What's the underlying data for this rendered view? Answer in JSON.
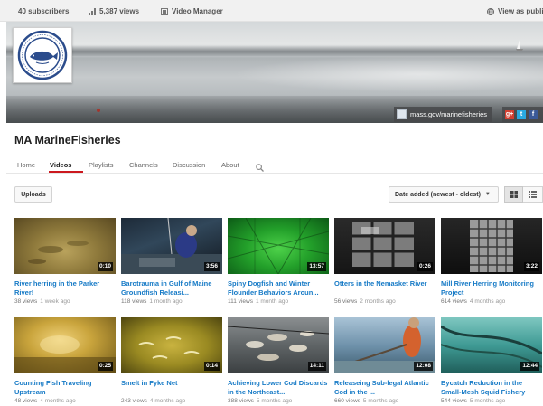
{
  "topbar": {
    "subscribers": "40 subscribers",
    "views": "5,387 views",
    "video_manager": "Video Manager",
    "view_as": "View as public"
  },
  "banner": {
    "site_link": "mass.gov/marinefisheries",
    "social_icons": [
      "google-plus-icon",
      "twitter-icon",
      "facebook-icon"
    ]
  },
  "channel": {
    "title": "MA MarineFisheries"
  },
  "tabs": [
    {
      "label": "Home"
    },
    {
      "label": "Videos",
      "active": true
    },
    {
      "label": "Playlists"
    },
    {
      "label": "Channels"
    },
    {
      "label": "Discussion"
    },
    {
      "label": "About"
    }
  ],
  "filters": {
    "uploads_label": "Uploads",
    "sort_label": "Date added (newest - oldest)"
  },
  "colors": {
    "accent_red": "#cc181e",
    "link_blue": "#167ac6"
  },
  "videos": [
    {
      "title": "River herring in the Parker River!",
      "duration": "0:10",
      "views": "38 views",
      "ago": "1 week ago"
    },
    {
      "title": "Barotrauma in Gulf of Maine Groundfish Releasi...",
      "duration": "3:56",
      "views": "118 views",
      "ago": "1 month ago"
    },
    {
      "title": "Spiny Dogfish and Winter Flounder Behaviors Aroun...",
      "duration": "13:57",
      "views": "111 views",
      "ago": "1 month ago"
    },
    {
      "title": "Otters in the Nemasket River",
      "duration": "0:26",
      "views": "56 views",
      "ago": "2 months ago"
    },
    {
      "title": "Mill River Herring Monitoring Project",
      "duration": "3:22",
      "views": "614 views",
      "ago": "4 months ago"
    },
    {
      "title": "Counting Fish Traveling Upstream",
      "duration": "0:25",
      "views": "48 views",
      "ago": "4 months ago"
    },
    {
      "title": "Smelt in Fyke Net",
      "duration": "0:14",
      "views": "243 views",
      "ago": "4 months ago"
    },
    {
      "title": "Achieving Lower Cod Discards in the Northeast...",
      "duration": "14:11",
      "views": "388 views",
      "ago": "5 months ago"
    },
    {
      "title": "Releaseing Sub-legal Atlantic Cod in the ...",
      "duration": "12:08",
      "views": "660 views",
      "ago": "5 months ago"
    },
    {
      "title": "Bycatch Reduction in the Small-Mesh Squid Fishery",
      "duration": "12:44",
      "views": "544 views",
      "ago": "5 months ago"
    }
  ]
}
